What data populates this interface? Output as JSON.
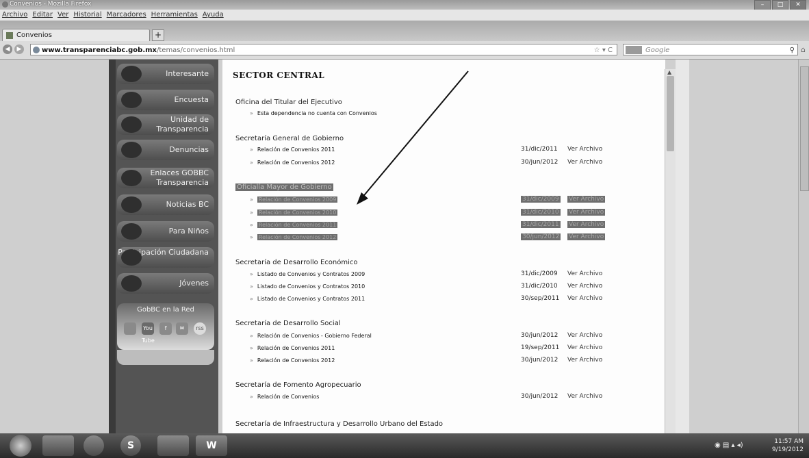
{
  "window": {
    "title": "Convenios - Mozilla Firefox",
    "controls": [
      "–",
      "□",
      "✕"
    ]
  },
  "menu": [
    "Archivo",
    "Editar",
    "Ver",
    "Historial",
    "Marcadores",
    "Herramientas",
    "Ayuda"
  ],
  "tab": {
    "label": "Convenios",
    "new_tab": "+"
  },
  "nav": {
    "url_host": "www.transparenciabc.gob.mx",
    "url_path": "/temas/convenios.html",
    "url_controls": "☆ ▾ C",
    "search_placeholder": "Google",
    "search_glyph": "⚲",
    "home_glyph": "⌂"
  },
  "sidebar": {
    "items": [
      {
        "label": "Interesante"
      },
      {
        "label": "Encuesta"
      },
      {
        "label": "Unidad de Transparencia"
      },
      {
        "label": "Denuncias"
      },
      {
        "label": "Enlaces GOBBC Transparencia"
      },
      {
        "label": "Noticias BC"
      },
      {
        "label": "Para Niños"
      },
      {
        "label": "Participación Ciudadana"
      },
      {
        "label": "Jóvenes"
      }
    ],
    "social_title": "GobBC en la Red",
    "social": [
      "You Tube",
      "f",
      "✉",
      "rss"
    ]
  },
  "content": {
    "heading": "SECTOR CENTRAL",
    "sections": [
      {
        "name": "Oficina del Titular del Ejecutivo",
        "items": [
          {
            "text": "Esta dependencia no cuenta con Convenios",
            "date": "",
            "link": ""
          }
        ]
      },
      {
        "name": "Secretaría General de Gobierno",
        "items": [
          {
            "text": "Relación de Convenios 2011",
            "date": "31/dic/2011",
            "link": "Ver Archivo"
          },
          {
            "text": "Relación de Convenios 2012",
            "date": "30/jun/2012",
            "link": "Ver Archivo"
          }
        ]
      },
      {
        "name": "Oficialía Mayor de Gobierno",
        "items": [
          {
            "text": "Relación de Convenios 2009",
            "date": "31/dic/2009",
            "link": "Ver Archivo"
          },
          {
            "text": "Relación de Convenios 2010",
            "date": "31/dic/2010",
            "link": "Ver Archivo"
          },
          {
            "text": "Relación de Convenios 2011",
            "date": "31/dic/2011",
            "link": "Ver Archivo"
          },
          {
            "text": "Relación de Convenios 2012",
            "date": "30/jun/2012",
            "link": "Ver Archivo"
          }
        ]
      },
      {
        "name": "Secretaría de Desarrollo Económico",
        "items": [
          {
            "text": "Listado de Convenios y Contratos 2009",
            "date": "31/dic/2009",
            "link": "Ver Archivo"
          },
          {
            "text": "Listado de Convenios y Contratos 2010",
            "date": "31/dic/2010",
            "link": "Ver Archivo"
          },
          {
            "text": "Listado de Convenios y Contratos 2011",
            "date": "30/sep/2011",
            "link": "Ver Archivo"
          }
        ]
      },
      {
        "name": "Secretaría de Desarrollo Social",
        "items": [
          {
            "text": "Relación de Convenios - Gobierno Federal",
            "date": "30/jun/2012",
            "link": "Ver Archivo"
          },
          {
            "text": "Relación de Convenios 2011",
            "date": "19/sep/2011",
            "link": "Ver Archivo"
          },
          {
            "text": "Relación de Convenios 2012",
            "date": "30/jun/2012",
            "link": "Ver Archivo"
          }
        ]
      },
      {
        "name": "Secretaría de Fomento Agropecuario",
        "items": [
          {
            "text": "Relación de Convenios",
            "date": "30/jun/2012",
            "link": "Ver Archivo"
          }
        ]
      },
      {
        "name": "Secretaría de Infraestructura y Desarrollo Urbano del Estado",
        "items": []
      }
    ],
    "bullet": "»"
  },
  "taskbar": {
    "apps": [
      "",
      "",
      "S",
      "",
      "W"
    ],
    "time": "11:57 AM",
    "date": "9/19/2012"
  }
}
